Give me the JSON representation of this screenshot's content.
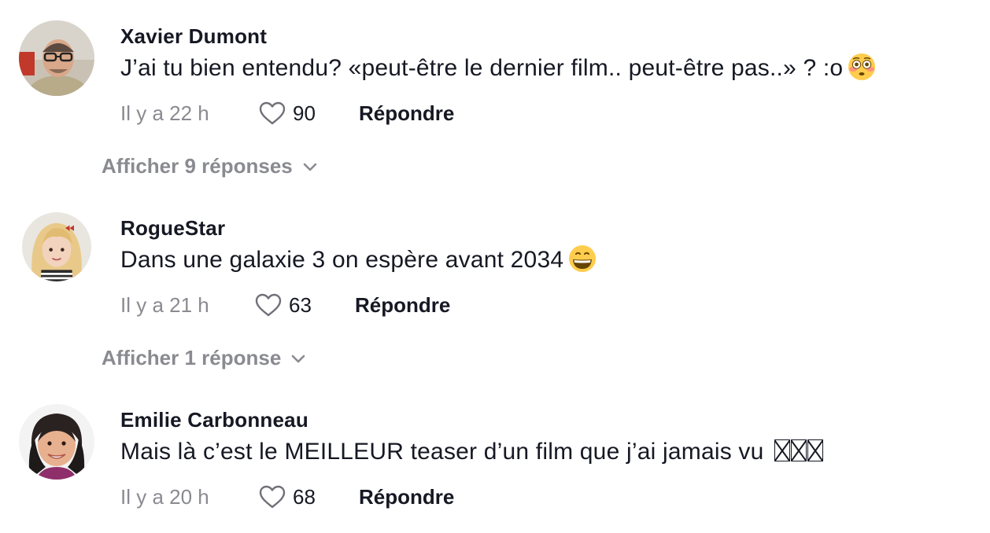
{
  "comments": [
    {
      "username": "Xavier Dumont",
      "text": "J’ai tu bien entendu? «peut-être le dernier film.. peut-être pas..» ? :o",
      "emoji": "flushed-face-emoji",
      "time": "Il y a 22 h",
      "likes": "90",
      "reply_label": "Répondre",
      "view_replies": "Afficher 9 réponses"
    },
    {
      "username": "RogueStar",
      "text": "Dans une galaxie 3 on espère avant 2034",
      "emoji": "grinning-face-emoji",
      "time": "Il y a 21 h",
      "likes": "63",
      "reply_label": "Répondre",
      "view_replies": "Afficher 1 réponse"
    },
    {
      "username": "Emilie Carbonneau",
      "text": "Mais là c’est le MEILLEUR teaser d’un film que j’ai jamais vu",
      "emoji": "missing-glyph-boxes",
      "time": "Il y a 20 h",
      "likes": "68",
      "reply_label": "Répondre"
    }
  ],
  "icons": {
    "like": "heart-outline-icon",
    "expand": "chevron-down-icon"
  },
  "colors": {
    "text_primary": "#161823",
    "text_secondary": "#8a8b91",
    "background": "#ffffff"
  }
}
